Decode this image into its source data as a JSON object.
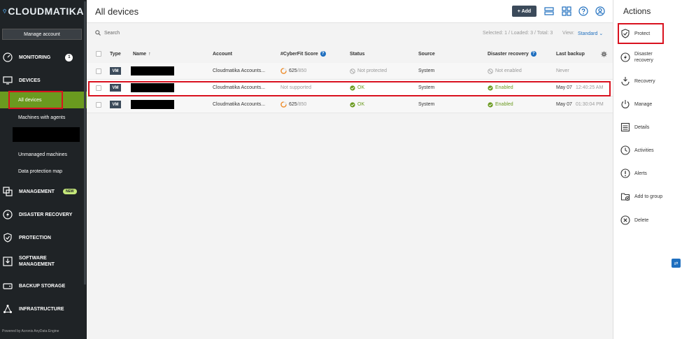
{
  "sidebar": {
    "logo_text": "CLOUDMATIKA",
    "manage_account": "Manage account",
    "sections": {
      "monitoring": "MONITORING",
      "monitoring_badge": "1",
      "devices": "DEVICES",
      "management": "MANAGEMENT",
      "management_badge": "NEW",
      "disaster_recovery": "DISASTER RECOVERY",
      "protection": "PROTECTION",
      "software_management": "SOFTWARE MANAGEMENT",
      "backup_storage": "BACKUP STORAGE",
      "infrastructure": "INFRASTRUCTURE"
    },
    "device_items": {
      "all_devices": "All devices",
      "machines_with_agents": "Machines with agents",
      "unmanaged_machines": "Unmanaged machines",
      "data_protection_map": "Data protection map"
    },
    "powered_by": "Powered by Acronis AnyData Engine"
  },
  "header": {
    "title": "All devices",
    "add_label": "+ Add"
  },
  "toolbar": {
    "search_placeholder": "Search",
    "selection_info": "Selected: 1 / Loaded: 3 / Total: 3",
    "view_label": "View:",
    "view_value": "Standard"
  },
  "table": {
    "columns": {
      "type": "Type",
      "name": "Name",
      "account": "Account",
      "cyberfit": "#CyberFit Score",
      "status": "Status",
      "source": "Source",
      "disaster_recovery": "Disaster recovery",
      "last_backup": "Last backup"
    },
    "rows": [
      {
        "type": "VM",
        "account": "Cloudmatika Accounts...",
        "cyberfit": "625",
        "cyberfit_max": "/850",
        "status": "Not protected",
        "source": "System",
        "dr": "Not enabled",
        "last_backup": "Never",
        "last_backup_time": ""
      },
      {
        "type": "VM",
        "account": "Cloudmatika Accounts...",
        "cyberfit": "Not supported",
        "cyberfit_max": "",
        "status": "OK",
        "source": "System",
        "dr": "Enabled",
        "last_backup": "May 07",
        "last_backup_time": "12:40:25 AM"
      },
      {
        "type": "VM",
        "account": "Cloudmatika Accounts...",
        "cyberfit": "625",
        "cyberfit_max": "/850",
        "status": "OK",
        "source": "System",
        "dr": "Enabled",
        "last_backup": "May 07",
        "last_backup_time": "01:30:04 PM"
      }
    ]
  },
  "actions": {
    "title": "Actions",
    "items": {
      "protect": "Protect",
      "disaster_recovery": "Disaster recovery",
      "recovery": "Recovery",
      "manage": "Manage",
      "details": "Details",
      "activities": "Activities",
      "alerts": "Alerts",
      "add_to_group": "Add to group",
      "delete": "Delete"
    }
  },
  "colors": {
    "sidebar_bg": "#1f2326",
    "accent_green": "#6a9a1f",
    "highlight_red": "#d9121f",
    "link_blue": "#1f6fbf"
  }
}
